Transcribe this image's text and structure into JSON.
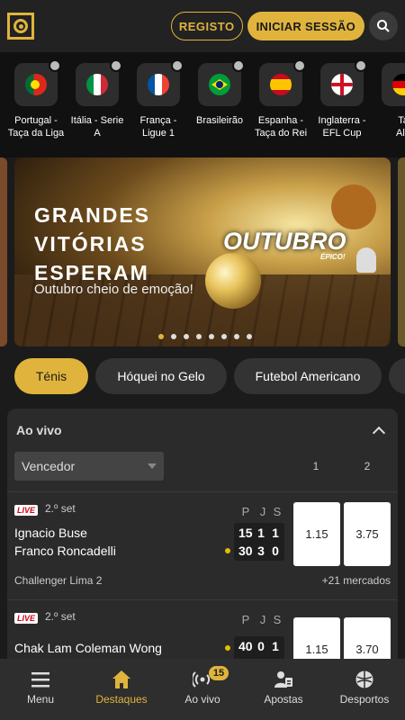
{
  "header": {
    "logo_icon": "target-logo-icon",
    "register_label": "REGISTO",
    "login_label": "INICIAR SESSÃO",
    "search_icon": "search-icon",
    "accent_color": "#e0b43c"
  },
  "leagues": [
    {
      "name_line1": "Portugal -",
      "name_line2": "Taça da Liga",
      "flag": "portugal"
    },
    {
      "name_line1": "Itália - Serie",
      "name_line2": "A",
      "flag": "italy"
    },
    {
      "name_line1": "França -",
      "name_line2": "Ligue 1",
      "flag": "france"
    },
    {
      "name_line1": "Brasileirão",
      "name_line2": "",
      "flag": "brazil"
    },
    {
      "name_line1": "Espanha -",
      "name_line2": "Taça do Rei",
      "flag": "spain"
    },
    {
      "name_line1": "Inglaterra -",
      "name_line2": "EFL Cup",
      "flag": "england"
    },
    {
      "name_line1": "Ta",
      "name_line2": "Ale",
      "flag": "germany"
    }
  ],
  "banner": {
    "title_line1": "GRANDES",
    "title_line2": "VITÓRIAS",
    "title_line3": "ESPERAM",
    "subtitle": "Outubro cheio de emoção!",
    "month": "OUTUBRO",
    "tag": "ÉPICO!",
    "slide_count": 8,
    "active_slide": 0
  },
  "sport_pills": [
    {
      "label": "Ténis",
      "active": true
    },
    {
      "label": "Hóquei no Gelo",
      "active": false
    },
    {
      "label": "Futebol Americano",
      "active": false
    },
    {
      "label": "",
      "active": false
    }
  ],
  "live": {
    "title": "Ao vivo",
    "market_select": "Vencedor",
    "col1": "1",
    "col2": "2",
    "score_headers": [
      "P",
      "J",
      "S"
    ],
    "matches": [
      {
        "badge": "LIVE",
        "period": "2.º set",
        "team1": "Ignacio Buse",
        "team2": "Franco Roncadelli",
        "score1": [
          "15",
          "1",
          "1"
        ],
        "score2": [
          "30",
          "3",
          "0"
        ],
        "serving": 2,
        "odd1": "1.15",
        "odd2": "3.75",
        "competition": "Challenger Lima 2",
        "markets": "+21 mercados"
      },
      {
        "badge": "LIVE",
        "period": "2.º set",
        "team1": "Chak Lam Coleman Wong",
        "team2": "",
        "score1": [
          "40",
          "0",
          "1"
        ],
        "score2": [
          "",
          "",
          ""
        ],
        "serving": 1,
        "odd1": "1.15",
        "odd2": "3.70",
        "competition": "",
        "markets": ""
      }
    ]
  },
  "bottom_nav": [
    {
      "label": "Menu",
      "icon": "hamburger-icon",
      "active": false
    },
    {
      "label": "Destaques",
      "icon": "home-icon",
      "active": true
    },
    {
      "label": "Ao vivo",
      "icon": "live-broadcast-icon",
      "active": false,
      "badge": "15"
    },
    {
      "label": "Apostas",
      "icon": "bet-slip-icon",
      "active": false
    },
    {
      "label": "Desportos",
      "icon": "sports-ball-icon",
      "active": false
    }
  ]
}
